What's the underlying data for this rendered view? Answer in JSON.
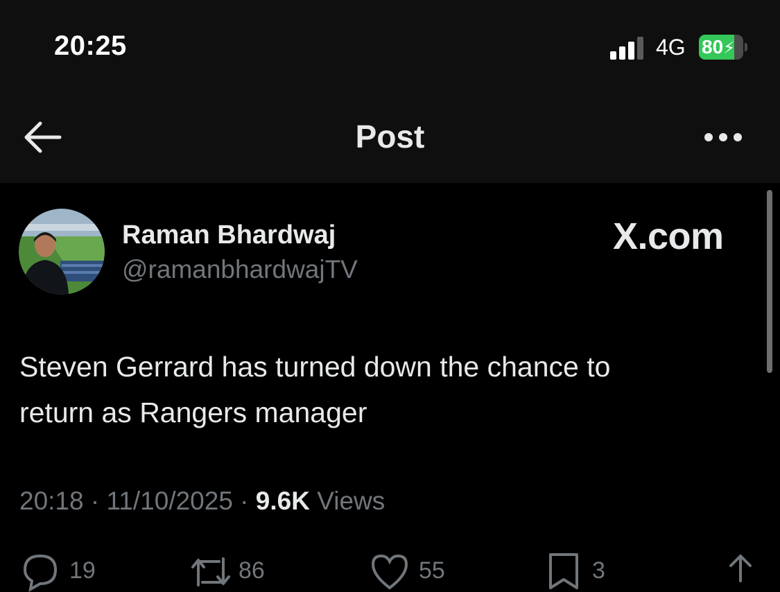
{
  "status_bar": {
    "time": "20:25",
    "network": "4G",
    "battery_percent": "80",
    "battery_level": 0.8,
    "battery_color": "#34c759"
  },
  "header": {
    "title": "Post",
    "back_icon": "arrow-left-icon",
    "more_icon": "more-horizontal-icon"
  },
  "post": {
    "author_name": "Raman Bhardwaj",
    "author_handle": "@ramanbhardwajTV",
    "watermark": "X.com",
    "text_line1": "Steven Gerrard has turned down the chance to",
    "text_line2": "return as Rangers manager",
    "timestamp": "20:18 · 11/10/2025 · ",
    "views_count": "9.6K",
    "views_label": " Views"
  },
  "actions": {
    "reply_count": "19",
    "repost_count": "86",
    "like_count": "55",
    "bookmark_count": "3"
  },
  "colors": {
    "background": "#000000",
    "header_background": "#0f0f0f",
    "primary_text": "#e7e9ea",
    "secondary_text": "#71767b"
  }
}
